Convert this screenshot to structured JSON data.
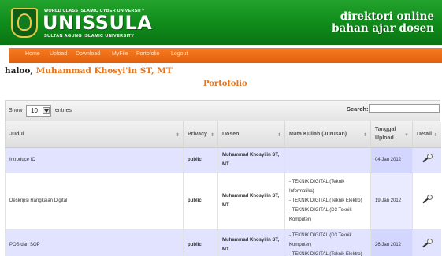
{
  "header": {
    "tagline": "WORLD CLASS ISLAMIC CYBER UNIVERSITY",
    "brand": "UNISSULA",
    "sub_tagline": "SULTAN AGUNG ISLAMIC UNIVERSITY",
    "site_title_line1": "direktori online",
    "site_title_line2": "bahan ajar dosen"
  },
  "nav": [
    "Home",
    "Upload",
    "Download",
    "MyFile",
    "Portofolio",
    "Logout"
  ],
  "greeting": {
    "prefix": "haloo, ",
    "name": "Muhammad Khosyi'in ST, MT"
  },
  "page_title": "Portofolio",
  "toolbar": {
    "show_label": "Show",
    "entries_value": "10",
    "entries_label": "entries",
    "search_label": "Search:",
    "search_value": ""
  },
  "table": {
    "columns": [
      "Judul",
      "Privacy",
      "Dosen",
      "Mata Kuliah (Jurusan)",
      "Tanggal Upload",
      "Detail"
    ],
    "rows": [
      {
        "judul": "Introduce IC",
        "privacy": "public",
        "dosen": "Muhammad Khosyi'in ST, MT",
        "mata_kuliah": [],
        "tanggal": "04 Jan 2012"
      },
      {
        "judul": "Deskripsi Rangkaian Digital",
        "privacy": "public",
        "dosen": "Muhammad Khosyi'in ST, MT",
        "mata_kuliah": [
          "- TEKNIK DIGITAL (Teknik Informatika)",
          "- TEKNIK DIGITAL (Teknik Elektro)",
          "- TEKNIK DIGITAL (D3 Teknik Komputer)"
        ],
        "tanggal": "19 Jan 2012"
      },
      {
        "judul": "POS dan SOP",
        "privacy": "public",
        "dosen": "Muhammad Khosyi'in ST, MT",
        "mata_kuliah": [
          "- TEKNIK DIGITAL (D3 Teknik Komputer)",
          "- TEKNIK DIGITAL (Teknik Elektro)"
        ],
        "tanggal": "26 Jan 2012"
      }
    ]
  },
  "icons": {
    "logo": "university-crest-icon",
    "detail": "magnifier-icon"
  },
  "colors": {
    "header_green": "#0f8a1a",
    "nav_orange": "#e2600d",
    "accent_orange": "#e8751a",
    "link_blue": "#2a3caa",
    "row_lavender": "#e2e4ff"
  }
}
